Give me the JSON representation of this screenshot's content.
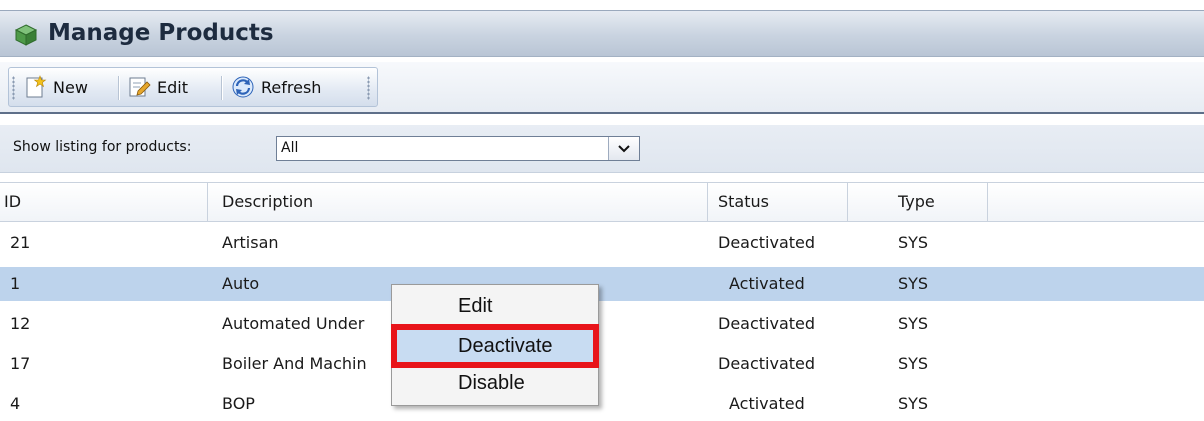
{
  "window": {
    "title": "Manage Products",
    "title_icon": "cube-icon"
  },
  "toolbar": {
    "new_label": "New",
    "edit_label": "Edit",
    "refresh_label": "Refresh"
  },
  "filter": {
    "label": "Show listing for products:",
    "selected": "All"
  },
  "grid": {
    "columns": [
      "ID",
      "Description",
      "Status",
      "Type"
    ],
    "rows": [
      {
        "id": "21",
        "description": "Artisan",
        "status": "Deactivated",
        "type": "SYS",
        "selected": false
      },
      {
        "id": "1",
        "description": "Auto",
        "status": "Activated",
        "type": "SYS",
        "selected": true
      },
      {
        "id": "12",
        "description": "Automated Under",
        "status": "Deactivated",
        "type": "SYS",
        "selected": false
      },
      {
        "id": "17",
        "description": "Boiler And Machin",
        "status": "Deactivated",
        "type": "SYS",
        "selected": false
      },
      {
        "id": "4",
        "description": "BOP",
        "status": "Activated",
        "type": "SYS",
        "selected": false
      }
    ]
  },
  "context_menu": {
    "items": [
      "Edit",
      "Deactivate",
      "Disable"
    ],
    "highlighted": "Deactivate",
    "highlight_color": "#e8141a"
  },
  "colors": {
    "selected_row": "#bdd3ec",
    "header_bg": "#c9d3e0"
  }
}
